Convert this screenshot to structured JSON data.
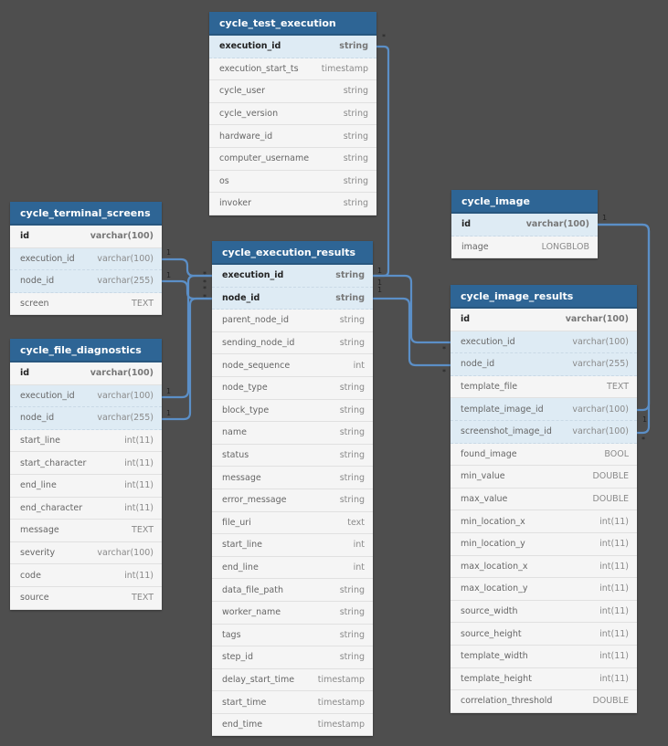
{
  "colors": {
    "background": "#4e4e4e",
    "header": "#2e6595",
    "key_row": "#deebf4",
    "row": "#f5f5f5",
    "link": "#5b8fc7"
  },
  "tables": [
    {
      "name": "cycle_test_execution",
      "columns": [
        {
          "name": "execution_id",
          "type": "string",
          "pk": true,
          "fk": true
        },
        {
          "name": "execution_start_ts",
          "type": "timestamp"
        },
        {
          "name": "cycle_user",
          "type": "string"
        },
        {
          "name": "cycle_version",
          "type": "string"
        },
        {
          "name": "hardware_id",
          "type": "string"
        },
        {
          "name": "computer_username",
          "type": "string"
        },
        {
          "name": "os",
          "type": "string"
        },
        {
          "name": "invoker",
          "type": "string"
        }
      ]
    },
    {
      "name": "cycle_terminal_screens",
      "columns": [
        {
          "name": "id",
          "type": "varchar(100)",
          "pk": true
        },
        {
          "name": "execution_id",
          "type": "varchar(100)",
          "fk": true
        },
        {
          "name": "node_id",
          "type": "varchar(255)",
          "fk": true
        },
        {
          "name": "screen",
          "type": "TEXT"
        }
      ]
    },
    {
      "name": "cycle_file_diagnostics",
      "columns": [
        {
          "name": "id",
          "type": "varchar(100)",
          "pk": true
        },
        {
          "name": "execution_id",
          "type": "varchar(100)",
          "fk": true
        },
        {
          "name": "node_id",
          "type": "varchar(255)",
          "fk": true
        },
        {
          "name": "start_line",
          "type": "int(11)"
        },
        {
          "name": "start_character",
          "type": "int(11)"
        },
        {
          "name": "end_line",
          "type": "int(11)"
        },
        {
          "name": "end_character",
          "type": "int(11)"
        },
        {
          "name": "message",
          "type": "TEXT"
        },
        {
          "name": "severity",
          "type": "varchar(100)"
        },
        {
          "name": "code",
          "type": "int(11)"
        },
        {
          "name": "source",
          "type": "TEXT"
        }
      ]
    },
    {
      "name": "cycle_execution_results",
      "columns": [
        {
          "name": "execution_id",
          "type": "string",
          "pk": true,
          "fk": true
        },
        {
          "name": "node_id",
          "type": "string",
          "pk": true,
          "fk": true
        },
        {
          "name": "parent_node_id",
          "type": "string"
        },
        {
          "name": "sending_node_id",
          "type": "string"
        },
        {
          "name": "node_sequence",
          "type": "int"
        },
        {
          "name": "node_type",
          "type": "string"
        },
        {
          "name": "block_type",
          "type": "string"
        },
        {
          "name": "name",
          "type": "string"
        },
        {
          "name": "status",
          "type": "string"
        },
        {
          "name": "message",
          "type": "string"
        },
        {
          "name": "error_message",
          "type": "string"
        },
        {
          "name": "file_uri",
          "type": "text"
        },
        {
          "name": "start_line",
          "type": "int"
        },
        {
          "name": "end_line",
          "type": "int"
        },
        {
          "name": "data_file_path",
          "type": "string"
        },
        {
          "name": "worker_name",
          "type": "string"
        },
        {
          "name": "tags",
          "type": "string"
        },
        {
          "name": "step_id",
          "type": "string"
        },
        {
          "name": "delay_start_time",
          "type": "timestamp"
        },
        {
          "name": "start_time",
          "type": "timestamp"
        },
        {
          "name": "end_time",
          "type": "timestamp"
        }
      ]
    },
    {
      "name": "cycle_image",
      "columns": [
        {
          "name": "id",
          "type": "varchar(100)",
          "pk": true,
          "fk": true
        },
        {
          "name": "image",
          "type": "LONGBLOB"
        }
      ]
    },
    {
      "name": "cycle_image_results",
      "columns": [
        {
          "name": "id",
          "type": "varchar(100)",
          "pk": true
        },
        {
          "name": "execution_id",
          "type": "varchar(100)",
          "fk": true
        },
        {
          "name": "node_id",
          "type": "varchar(255)",
          "fk": true
        },
        {
          "name": "template_file",
          "type": "TEXT"
        },
        {
          "name": "template_image_id",
          "type": "varchar(100)",
          "fk": true
        },
        {
          "name": "screenshot_image_id",
          "type": "varchar(100)",
          "fk": true
        },
        {
          "name": "found_image",
          "type": "BOOL"
        },
        {
          "name": "min_value",
          "type": "DOUBLE"
        },
        {
          "name": "max_value",
          "type": "DOUBLE"
        },
        {
          "name": "min_location_x",
          "type": "int(11)"
        },
        {
          "name": "min_location_y",
          "type": "int(11)"
        },
        {
          "name": "max_location_x",
          "type": "int(11)"
        },
        {
          "name": "max_location_y",
          "type": "int(11)"
        },
        {
          "name": "source_width",
          "type": "int(11)"
        },
        {
          "name": "source_height",
          "type": "int(11)"
        },
        {
          "name": "template_width",
          "type": "int(11)"
        },
        {
          "name": "template_height",
          "type": "int(11)"
        },
        {
          "name": "correlation_threshold",
          "type": "DOUBLE"
        }
      ]
    }
  ],
  "relationships": [
    {
      "from": "cycle_test_execution.execution_id",
      "to": "cycle_execution_results.execution_id",
      "from_card": "*",
      "to_card": "1"
    },
    {
      "from": "cycle_execution_results.execution_id",
      "to": "cycle_image_results.execution_id",
      "from_card": "1",
      "to_card": "*"
    },
    {
      "from": "cycle_execution_results.node_id",
      "to": "cycle_image_results.node_id",
      "from_card": "1",
      "to_card": "*"
    },
    {
      "from": "cycle_terminal_screens.execution_id",
      "to": "cycle_execution_results.execution_id",
      "from_card": "1",
      "to_card": "*"
    },
    {
      "from": "cycle_terminal_screens.node_id",
      "to": "cycle_execution_results.node_id",
      "from_card": "1",
      "to_card": "*"
    },
    {
      "from": "cycle_file_diagnostics.execution_id",
      "to": "cycle_execution_results.execution_id",
      "from_card": "1",
      "to_card": "*"
    },
    {
      "from": "cycle_file_diagnostics.node_id",
      "to": "cycle_execution_results.node_id",
      "from_card": "1",
      "to_card": "*"
    },
    {
      "from": "cycle_image.id",
      "to": "cycle_image_results.template_image_id",
      "from_card": "1",
      "to_card": "1"
    },
    {
      "from": "cycle_image.id",
      "to": "cycle_image_results.screenshot_image_id",
      "from_card": "1",
      "to_card": "*"
    }
  ]
}
